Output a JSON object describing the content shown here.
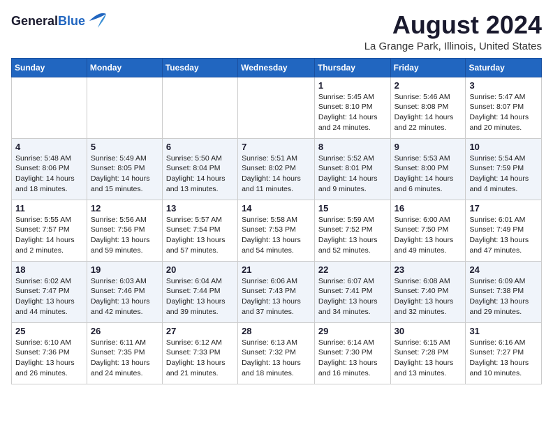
{
  "logo": {
    "general": "General",
    "blue": "Blue"
  },
  "title": {
    "month": "August 2024",
    "location": "La Grange Park, Illinois, United States"
  },
  "headers": [
    "Sunday",
    "Monday",
    "Tuesday",
    "Wednesday",
    "Thursday",
    "Friday",
    "Saturday"
  ],
  "weeks": [
    [
      {
        "day": "",
        "info": ""
      },
      {
        "day": "",
        "info": ""
      },
      {
        "day": "",
        "info": ""
      },
      {
        "day": "",
        "info": ""
      },
      {
        "day": "1",
        "info": "Sunrise: 5:45 AM\nSunset: 8:10 PM\nDaylight: 14 hours\nand 24 minutes."
      },
      {
        "day": "2",
        "info": "Sunrise: 5:46 AM\nSunset: 8:08 PM\nDaylight: 14 hours\nand 22 minutes."
      },
      {
        "day": "3",
        "info": "Sunrise: 5:47 AM\nSunset: 8:07 PM\nDaylight: 14 hours\nand 20 minutes."
      }
    ],
    [
      {
        "day": "4",
        "info": "Sunrise: 5:48 AM\nSunset: 8:06 PM\nDaylight: 14 hours\nand 18 minutes."
      },
      {
        "day": "5",
        "info": "Sunrise: 5:49 AM\nSunset: 8:05 PM\nDaylight: 14 hours\nand 15 minutes."
      },
      {
        "day": "6",
        "info": "Sunrise: 5:50 AM\nSunset: 8:04 PM\nDaylight: 14 hours\nand 13 minutes."
      },
      {
        "day": "7",
        "info": "Sunrise: 5:51 AM\nSunset: 8:02 PM\nDaylight: 14 hours\nand 11 minutes."
      },
      {
        "day": "8",
        "info": "Sunrise: 5:52 AM\nSunset: 8:01 PM\nDaylight: 14 hours\nand 9 minutes."
      },
      {
        "day": "9",
        "info": "Sunrise: 5:53 AM\nSunset: 8:00 PM\nDaylight: 14 hours\nand 6 minutes."
      },
      {
        "day": "10",
        "info": "Sunrise: 5:54 AM\nSunset: 7:59 PM\nDaylight: 14 hours\nand 4 minutes."
      }
    ],
    [
      {
        "day": "11",
        "info": "Sunrise: 5:55 AM\nSunset: 7:57 PM\nDaylight: 14 hours\nand 2 minutes."
      },
      {
        "day": "12",
        "info": "Sunrise: 5:56 AM\nSunset: 7:56 PM\nDaylight: 13 hours\nand 59 minutes."
      },
      {
        "day": "13",
        "info": "Sunrise: 5:57 AM\nSunset: 7:54 PM\nDaylight: 13 hours\nand 57 minutes."
      },
      {
        "day": "14",
        "info": "Sunrise: 5:58 AM\nSunset: 7:53 PM\nDaylight: 13 hours\nand 54 minutes."
      },
      {
        "day": "15",
        "info": "Sunrise: 5:59 AM\nSunset: 7:52 PM\nDaylight: 13 hours\nand 52 minutes."
      },
      {
        "day": "16",
        "info": "Sunrise: 6:00 AM\nSunset: 7:50 PM\nDaylight: 13 hours\nand 49 minutes."
      },
      {
        "day": "17",
        "info": "Sunrise: 6:01 AM\nSunset: 7:49 PM\nDaylight: 13 hours\nand 47 minutes."
      }
    ],
    [
      {
        "day": "18",
        "info": "Sunrise: 6:02 AM\nSunset: 7:47 PM\nDaylight: 13 hours\nand 44 minutes."
      },
      {
        "day": "19",
        "info": "Sunrise: 6:03 AM\nSunset: 7:46 PM\nDaylight: 13 hours\nand 42 minutes."
      },
      {
        "day": "20",
        "info": "Sunrise: 6:04 AM\nSunset: 7:44 PM\nDaylight: 13 hours\nand 39 minutes."
      },
      {
        "day": "21",
        "info": "Sunrise: 6:06 AM\nSunset: 7:43 PM\nDaylight: 13 hours\nand 37 minutes."
      },
      {
        "day": "22",
        "info": "Sunrise: 6:07 AM\nSunset: 7:41 PM\nDaylight: 13 hours\nand 34 minutes."
      },
      {
        "day": "23",
        "info": "Sunrise: 6:08 AM\nSunset: 7:40 PM\nDaylight: 13 hours\nand 32 minutes."
      },
      {
        "day": "24",
        "info": "Sunrise: 6:09 AM\nSunset: 7:38 PM\nDaylight: 13 hours\nand 29 minutes."
      }
    ],
    [
      {
        "day": "25",
        "info": "Sunrise: 6:10 AM\nSunset: 7:36 PM\nDaylight: 13 hours\nand 26 minutes."
      },
      {
        "day": "26",
        "info": "Sunrise: 6:11 AM\nSunset: 7:35 PM\nDaylight: 13 hours\nand 24 minutes."
      },
      {
        "day": "27",
        "info": "Sunrise: 6:12 AM\nSunset: 7:33 PM\nDaylight: 13 hours\nand 21 minutes."
      },
      {
        "day": "28",
        "info": "Sunrise: 6:13 AM\nSunset: 7:32 PM\nDaylight: 13 hours\nand 18 minutes."
      },
      {
        "day": "29",
        "info": "Sunrise: 6:14 AM\nSunset: 7:30 PM\nDaylight: 13 hours\nand 16 minutes."
      },
      {
        "day": "30",
        "info": "Sunrise: 6:15 AM\nSunset: 7:28 PM\nDaylight: 13 hours\nand 13 minutes."
      },
      {
        "day": "31",
        "info": "Sunrise: 6:16 AM\nSunset: 7:27 PM\nDaylight: 13 hours\nand 10 minutes."
      }
    ]
  ]
}
